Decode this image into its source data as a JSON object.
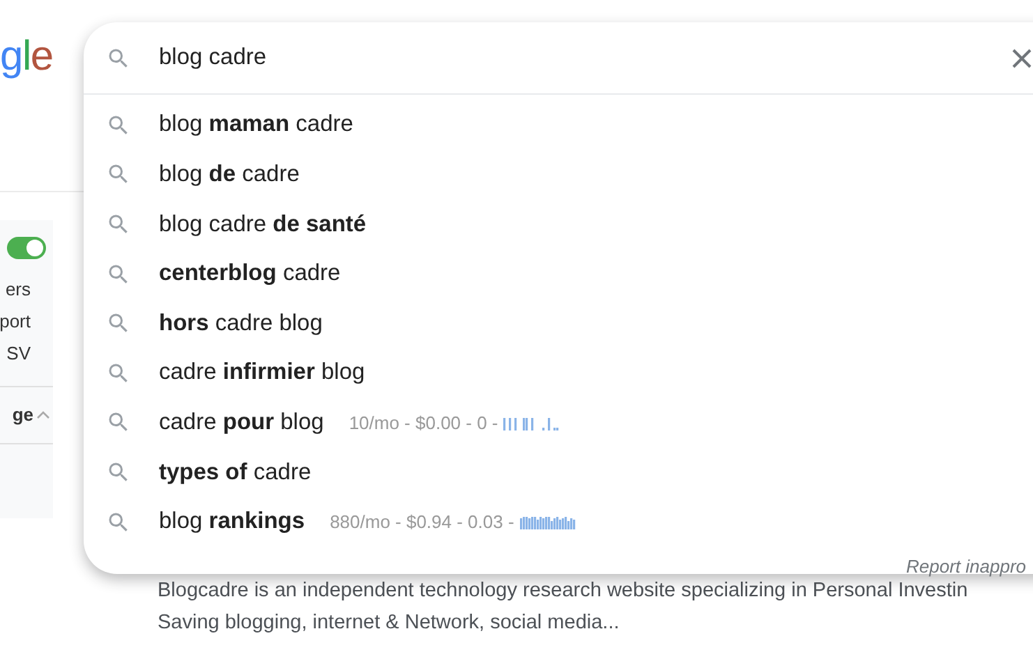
{
  "logo": {
    "letters": [
      {
        "text": "g",
        "color": "#4285f4"
      },
      {
        "text": "l",
        "color": "#34a853"
      },
      {
        "text": "e",
        "color": "#b2553f"
      }
    ]
  },
  "side_panel": {
    "toggle": {
      "on": true
    },
    "items": [
      "ers",
      "port",
      "SV"
    ],
    "section": {
      "label": "ge",
      "expanded": true
    }
  },
  "search": {
    "value": "blog cadre"
  },
  "suggestions": [
    {
      "text": "blog **maman** cadre"
    },
    {
      "text": "blog **de** cadre"
    },
    {
      "text": "blog cadre **de santé**"
    },
    {
      "text": "**centerblog** cadre"
    },
    {
      "text": "**hors** cadre blog"
    },
    {
      "text": "cadre **infirmier** blog"
    },
    {
      "text": "cadre **pour** blog",
      "stats": "10/mo - $0.00 - 0 -"
    },
    {
      "text": "**types of** cadre"
    },
    {
      "text": "blog **rankings**",
      "stats": "880/mo - $0.94 - 0.03 -"
    }
  ],
  "report_link": "Report inappro",
  "result": {
    "snippet_lines": [
      "Blogcadre is an independent technology research website specializing in Personal Investin",
      "Saving blogging, internet & Network, social media..."
    ]
  }
}
